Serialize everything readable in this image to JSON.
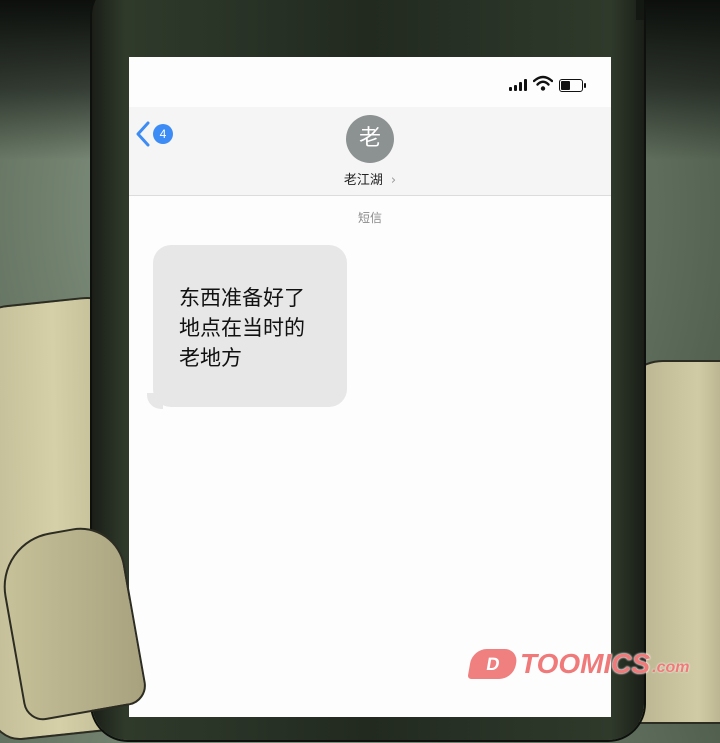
{
  "status_bar": {
    "icons": [
      "signal-icon",
      "wifi-icon",
      "battery-icon"
    ]
  },
  "header": {
    "back_icon": "chevron-left-icon",
    "unread_count": "4",
    "avatar_initial": "老",
    "contact_name": "老江湖",
    "contact_chevron": "›"
  },
  "conversation": {
    "service_label": "短信",
    "messages": [
      {
        "direction": "incoming",
        "lines": [
          "东西准备好了",
          "地点在当时的",
          "老地方"
        ]
      }
    ]
  },
  "watermark": {
    "logo_text": "D",
    "brand": "TOOMICS",
    "domain": ".com"
  },
  "colors": {
    "accent": "#3d8bf5",
    "bubble_incoming": "#e7e7e7",
    "avatar_bg": "#8c9292",
    "watermark": "#f07a7a"
  }
}
